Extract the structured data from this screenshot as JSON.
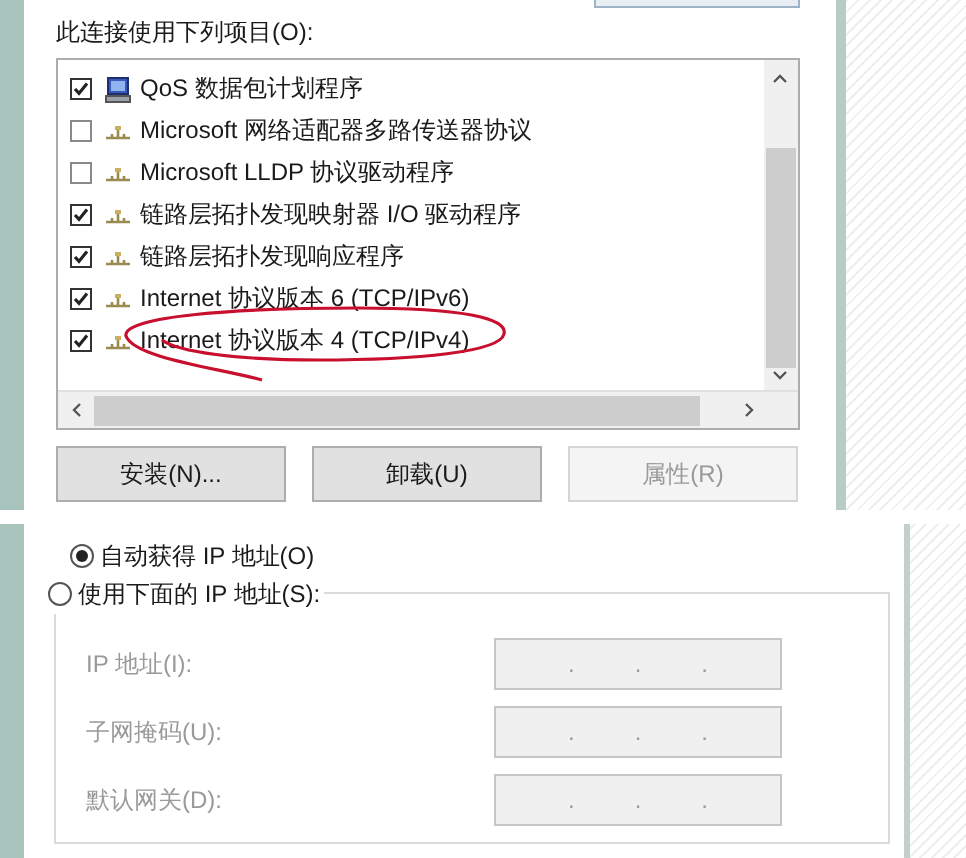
{
  "components": {
    "label": "此连接使用下列项目(O):",
    "items": [
      {
        "kind": "service",
        "label": "QoS 数据包计划程序",
        "checked": true
      },
      {
        "kind": "protocol",
        "label": "Microsoft 网络适配器多路传送器协议",
        "checked": false
      },
      {
        "kind": "protocol",
        "label": "Microsoft LLDP 协议驱动程序",
        "checked": false
      },
      {
        "kind": "protocol",
        "label": "链路层拓扑发现映射器 I/O 驱动程序",
        "checked": true
      },
      {
        "kind": "protocol",
        "label": "链路层拓扑发现响应程序",
        "checked": true
      },
      {
        "kind": "protocol",
        "label": "Internet 协议版本 6 (TCP/IPv6)",
        "checked": true
      },
      {
        "kind": "protocol",
        "label": "Internet 协议版本 4 (TCP/IPv4)",
        "checked": true,
        "circled": true
      }
    ],
    "buttons": [
      {
        "label": "安装(N)...",
        "disabled": false
      },
      {
        "label": "卸载(U)",
        "disabled": false
      },
      {
        "label": "属性(R)",
        "disabled": true
      }
    ]
  },
  "ip_settings": {
    "options": [
      {
        "label": "自动获得 IP 地址(O)",
        "selected": true
      },
      {
        "label": "使用下面的 IP 地址(S):",
        "selected": false
      }
    ],
    "fields": [
      {
        "label": "IP 地址(I):",
        "separators": [
          ".",
          ".",
          "."
        ]
      },
      {
        "label": "子网掩码(U):",
        "separators": [
          ".",
          ".",
          "."
        ]
      },
      {
        "label": "默认网关(D):",
        "separators": [
          ".",
          ".",
          "."
        ]
      }
    ]
  }
}
